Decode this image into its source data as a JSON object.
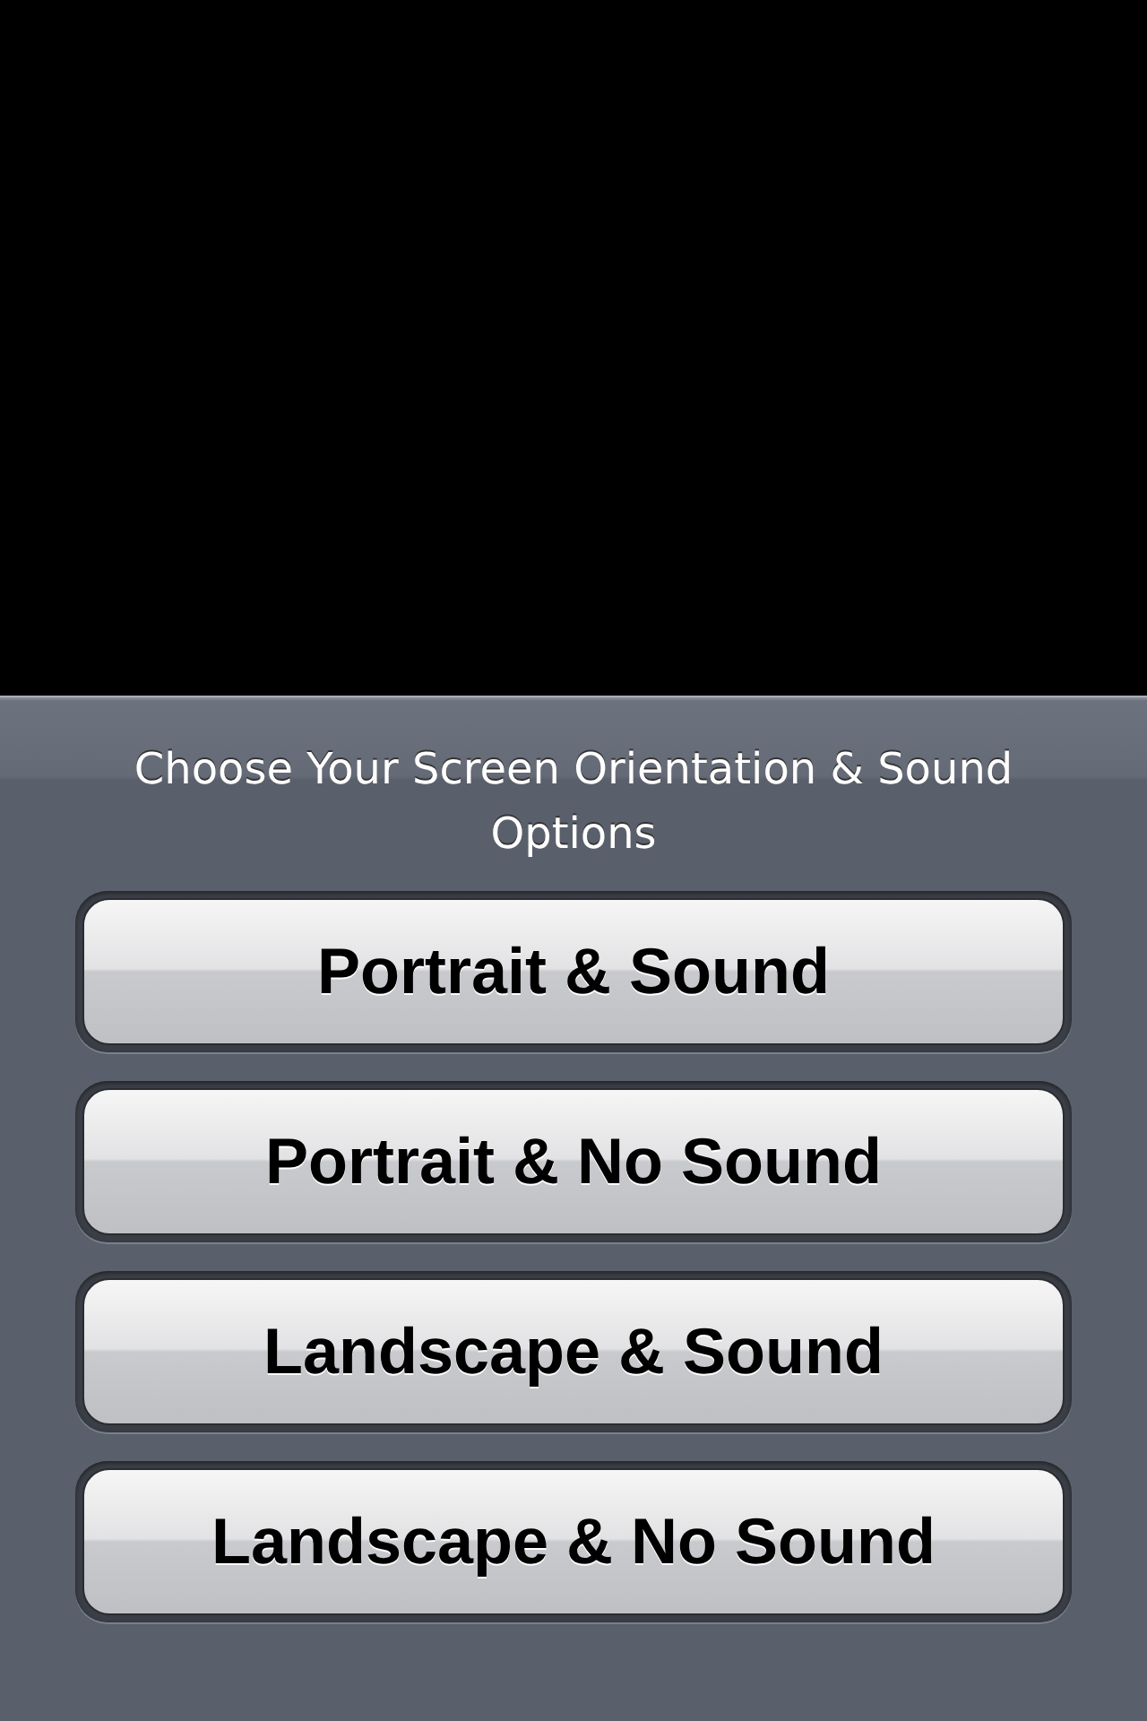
{
  "action_sheet": {
    "title": "Choose Your Screen Orientation & Sound Options",
    "buttons": [
      {
        "label": "Portrait & Sound"
      },
      {
        "label": "Portrait & No Sound"
      },
      {
        "label": "Landscape & Sound"
      },
      {
        "label": "Landscape & No Sound"
      }
    ]
  }
}
